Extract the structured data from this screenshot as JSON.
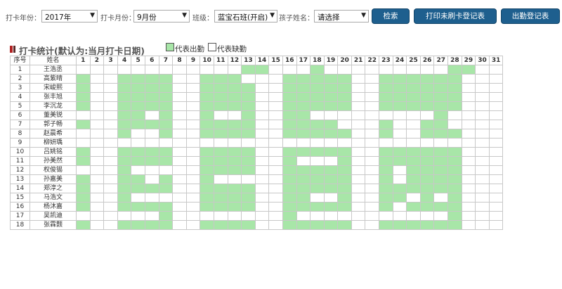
{
  "filters": {
    "year_label": "打卡年份：",
    "year_value": "2017年",
    "month_label": "打卡月份：",
    "month_value": "9月份",
    "class_label": "班级：",
    "class_value": "蓝宝石班(开启)",
    "child_label": "孩子姓名：",
    "child_value": "请选择"
  },
  "buttons": {
    "search": "检索",
    "print_unswiped": "打印未刷卡登记表",
    "attendance_form": "出勤登记表"
  },
  "section": {
    "title": "打卡统计(默认为:当月打卡日期)",
    "legend_present": "代表出勤",
    "legend_absent": "代表缺勤"
  },
  "colors": {
    "present": "#a8e6a8",
    "absent": "#ffffff",
    "button": "#1e5f8e"
  },
  "table": {
    "col_index": "序号",
    "col_name": "姓名",
    "days": [
      "1",
      "2",
      "3",
      "4",
      "5",
      "6",
      "7",
      "8",
      "9",
      "10",
      "11",
      "12",
      "13",
      "14",
      "15",
      "16",
      "17",
      "18",
      "19",
      "20",
      "21",
      "22",
      "23",
      "24",
      "25",
      "26",
      "27",
      "28",
      "29",
      "30",
      "31"
    ],
    "rows": [
      {
        "index": "1",
        "name": "王浩丞",
        "att": "0000000000001100010000000001100"
      },
      {
        "index": "2",
        "name": "高紫晴",
        "att": "1001111001110001111100111111000"
      },
      {
        "index": "3",
        "name": "宋峻熙",
        "att": "1001111001111001111100111111000"
      },
      {
        "index": "4",
        "name": "张丰旭",
        "att": "1001111001111001111100111111000"
      },
      {
        "index": "5",
        "name": "李沉龙",
        "att": "1001111001111001111100111111000"
      },
      {
        "index": "6",
        "name": "董美锐",
        "att": "0001101001001001100000000010000"
      },
      {
        "index": "7",
        "name": "郭子畅",
        "att": "1001111001111001111000100110000"
      },
      {
        "index": "8",
        "name": "赵晨希",
        "att": "0001001001111001111100100111000"
      },
      {
        "index": "9",
        "name": "柳妍瑀",
        "att": "0000000000000000000000000000000"
      },
      {
        "index": "10",
        "name": "吕姚铭",
        "att": "1001111001111001111100111111000"
      },
      {
        "index": "11",
        "name": "孙美然",
        "att": "1001111001111001000100111111000"
      },
      {
        "index": "12",
        "name": "权俊锡",
        "att": "0001000001111001111100101111000"
      },
      {
        "index": "13",
        "name": "孙嘉美",
        "att": "1001101001000001111100101111000"
      },
      {
        "index": "14",
        "name": "郑淳之",
        "att": "1001111001111001111100111111000"
      },
      {
        "index": "15",
        "name": "马浩文",
        "att": "1001000001111001100100110101000"
      },
      {
        "index": "16",
        "name": "杨沐嘉",
        "att": "1001111001111001111100101111000"
      },
      {
        "index": "17",
        "name": "吴凯迪",
        "att": "0000001000000001000000000001000"
      },
      {
        "index": "18",
        "name": "张霖颢",
        "att": "1001111001111001111100111111000"
      }
    ]
  }
}
